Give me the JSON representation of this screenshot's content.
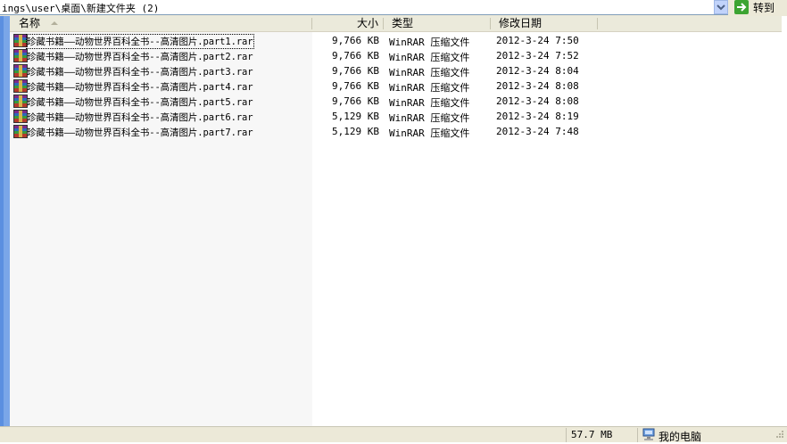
{
  "address": {
    "path": "ings\\user\\桌面\\新建文件夹 (2)",
    "go_label": "转到"
  },
  "columns": {
    "name": "名称",
    "size": "大小",
    "type": "类型",
    "modified": "修改日期"
  },
  "files": [
    {
      "name": "珍藏书籍——动物世界百科全书--高清图片.part1.rar",
      "size": "9,766 KB",
      "type": "WinRAR 压缩文件",
      "modified": "2012-3-24 7:50"
    },
    {
      "name": "珍藏书籍——动物世界百科全书--高清图片.part2.rar",
      "size": "9,766 KB",
      "type": "WinRAR 压缩文件",
      "modified": "2012-3-24 7:52"
    },
    {
      "name": "珍藏书籍——动物世界百科全书--高清图片.part3.rar",
      "size": "9,766 KB",
      "type": "WinRAR 压缩文件",
      "modified": "2012-3-24 8:04"
    },
    {
      "name": "珍藏书籍——动物世界百科全书--高清图片.part4.rar",
      "size": "9,766 KB",
      "type": "WinRAR 压缩文件",
      "modified": "2012-3-24 8:08"
    },
    {
      "name": "珍藏书籍——动物世界百科全书--高清图片.part5.rar",
      "size": "9,766 KB",
      "type": "WinRAR 压缩文件",
      "modified": "2012-3-24 8:08"
    },
    {
      "name": "珍藏书籍——动物世界百科全书--高清图片.part6.rar",
      "size": "5,129 KB",
      "type": "WinRAR 压缩文件",
      "modified": "2012-3-24 8:19"
    },
    {
      "name": "珍藏书籍——动物世界百科全书--高清图片.part7.rar",
      "size": "5,129 KB",
      "type": "WinRAR 压缩文件",
      "modified": "2012-3-24 7:48"
    }
  ],
  "status": {
    "total_size": "57.7 MB",
    "location": "我的电脑"
  },
  "icons": {
    "file": "winrar-archive-icon",
    "go": "go-arrow-icon",
    "computer": "my-computer-icon"
  },
  "colors": {
    "accent": "#3ca432",
    "edge": "#7aa6e8",
    "toolbar": "#ece9d8"
  }
}
